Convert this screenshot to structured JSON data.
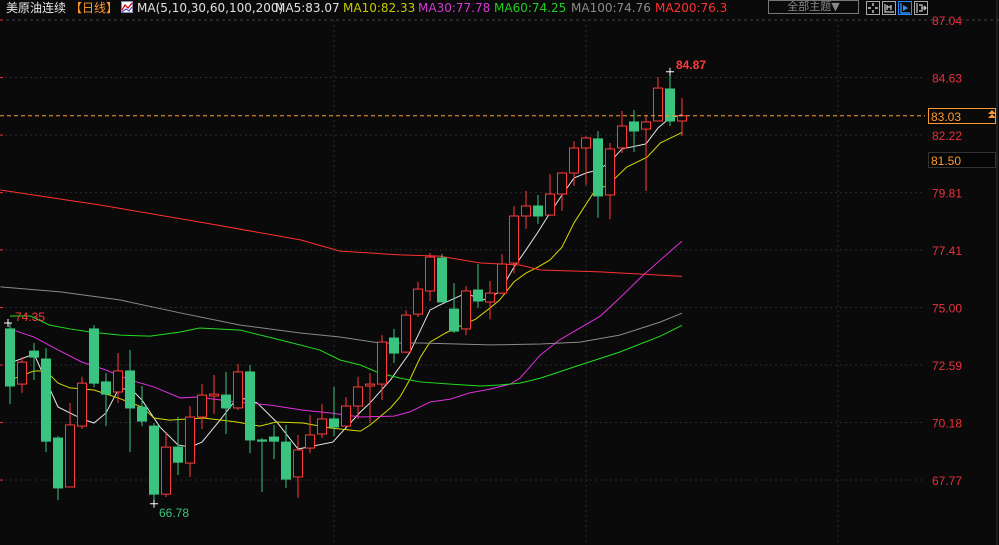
{
  "header": {
    "title": "美原油连续",
    "period": "【日线】",
    "ma_params": "MA(5,10,30,60,100,200)",
    "ma5": "MA5:83.07",
    "ma10": "MA10:82.33",
    "ma30": "MA30:77.78",
    "ma60": "MA60:74.25",
    "ma100": "MA100:74.76",
    "ma200": "MA200:76.3"
  },
  "toolbar": {
    "theme_dropdown": "全部主题▼",
    "icons": [
      "crosshair-icon",
      "range-icon",
      "play-icon",
      "move-right-icon"
    ]
  },
  "price_tags": {
    "current": "83.03",
    "cursor": "81.50"
  },
  "colors": {
    "background": "#0a0a0a",
    "up": "#ff3b3b",
    "down": "#3ac47f",
    "axis_text": "#e8323c",
    "ma5": "#e8e8e8",
    "ma10": "#d8d800",
    "ma30": "#e030e0",
    "ma60": "#22dd22",
    "ma100": "#8a8a8a",
    "ma200": "#ff3030",
    "current_line": "#ff9a2e"
  },
  "chart_data": {
    "type": "candlestick",
    "ylim": [
      65.05,
      87.04
    ],
    "y_ticks": [
      "87.04",
      "84.63",
      "82.22",
      "79.81",
      "77.41",
      "75.00",
      "72.59",
      "70.18",
      "67.77"
    ],
    "grid": true,
    "current_price": 83.03,
    "annotations": {
      "high": "84.87",
      "low": "66.78",
      "left_high": "74.35"
    },
    "ohlc": [
      [
        74.1,
        74.35,
        70.95,
        71.71
      ],
      [
        71.79,
        72.92,
        71.42,
        72.71
      ],
      [
        73.17,
        73.51,
        71.96,
        72.92
      ],
      [
        72.84,
        73.3,
        68.94,
        69.4
      ],
      [
        69.53,
        69.61,
        66.93,
        67.44
      ],
      [
        67.48,
        71.0,
        67.48,
        70.08
      ],
      [
        70.03,
        72.09,
        69.91,
        71.83
      ],
      [
        74.1,
        74.26,
        71.67,
        71.83
      ],
      [
        71.88,
        72.25,
        70.03,
        71.37
      ],
      [
        71.46,
        73.09,
        71.0,
        72.34
      ],
      [
        72.34,
        73.22,
        68.94,
        70.79
      ],
      [
        70.83,
        71.71,
        70.03,
        70.24
      ],
      [
        70.03,
        70.16,
        66.78,
        67.18
      ],
      [
        67.18,
        69.74,
        67.06,
        69.15
      ],
      [
        69.15,
        70.41,
        67.98,
        68.52
      ],
      [
        68.48,
        70.87,
        67.9,
        70.41
      ],
      [
        70.41,
        71.79,
        69.91,
        71.33
      ],
      [
        71.29,
        72.17,
        70.54,
        71.37
      ],
      [
        71.33,
        72.3,
        69.7,
        70.79
      ],
      [
        70.79,
        72.63,
        70.7,
        72.3
      ],
      [
        72.3,
        72.59,
        68.9,
        69.45
      ],
      [
        69.45,
        69.53,
        67.27,
        69.4
      ],
      [
        69.57,
        70.09,
        68.65,
        69.4
      ],
      [
        69.36,
        70.08,
        67.44,
        67.81
      ],
      [
        67.9,
        69.66,
        67.02,
        69.03
      ],
      [
        69.11,
        70.49,
        68.9,
        69.66
      ],
      [
        69.7,
        70.95,
        69.53,
        70.33
      ],
      [
        70.33,
        71.67,
        69.61,
        69.99
      ],
      [
        70.03,
        71.25,
        69.99,
        70.87
      ],
      [
        70.87,
        72.09,
        70.33,
        71.67
      ],
      [
        71.71,
        72.25,
        70.16,
        71.79
      ],
      [
        71.79,
        73.84,
        71.12,
        73.55
      ],
      [
        73.72,
        74.1,
        72.67,
        73.09
      ],
      [
        73.13,
        74.89,
        73.09,
        74.68
      ],
      [
        74.72,
        76.07,
        74.6,
        75.77
      ],
      [
        75.69,
        77.28,
        75.27,
        77.11
      ],
      [
        77.07,
        77.24,
        75.23,
        75.23
      ],
      [
        74.93,
        76.02,
        73.93,
        74.01
      ],
      [
        74.1,
        75.9,
        73.84,
        75.69
      ],
      [
        75.73,
        76.82,
        74.98,
        75.27
      ],
      [
        75.23,
        76.11,
        74.51,
        75.6
      ],
      [
        75.6,
        77.24,
        75.56,
        76.82
      ],
      [
        76.86,
        79.25,
        76.44,
        78.83
      ],
      [
        78.83,
        79.88,
        78.29,
        79.25
      ],
      [
        79.25,
        79.71,
        78.5,
        78.83
      ],
      [
        78.87,
        80.59,
        78.83,
        79.75
      ],
      [
        79.75,
        80.67,
        79.04,
        80.63
      ],
      [
        80.63,
        81.97,
        80.09,
        81.68
      ],
      [
        81.68,
        82.18,
        80.13,
        82.1
      ],
      [
        82.06,
        82.39,
        78.76,
        79.67
      ],
      [
        79.71,
        81.89,
        78.7,
        81.64
      ],
      [
        81.68,
        83.23,
        81.47,
        82.6
      ],
      [
        82.77,
        83.27,
        81.51,
        82.39
      ],
      [
        82.47,
        83.06,
        79.88,
        82.77
      ],
      [
        82.81,
        84.65,
        82.81,
        84.19
      ],
      [
        84.15,
        84.87,
        82.6,
        82.81
      ],
      [
        82.81,
        83.77,
        82.18,
        83.03
      ]
    ],
    "ma_series": [
      {
        "name": "MA5",
        "color": "#e8e8e8",
        "points": [
          [
            0,
            72.67
          ],
          [
            2,
            73.05
          ],
          [
            4,
            70.83
          ],
          [
            6,
            70.33
          ],
          [
            7,
            70.16
          ],
          [
            8,
            70.58
          ],
          [
            9,
            71.54
          ],
          [
            10,
            71.63
          ],
          [
            11,
            71.12
          ],
          [
            12.5,
            69.99
          ],
          [
            14,
            69.24
          ],
          [
            15,
            69.15
          ],
          [
            16,
            69.36
          ],
          [
            17.5,
            70.28
          ],
          [
            19,
            71.25
          ],
          [
            20.6,
            71.0
          ],
          [
            22.3,
            70.16
          ],
          [
            24,
            69.07
          ],
          [
            26.9,
            69.36
          ],
          [
            29.2,
            70.62
          ],
          [
            30,
            71.0
          ],
          [
            31.7,
            71.96
          ],
          [
            33.3,
            73.09
          ],
          [
            35,
            74.89
          ],
          [
            35.8,
            75.1
          ],
          [
            38,
            75.6
          ],
          [
            39.4,
            75.31
          ],
          [
            40.8,
            75.65
          ],
          [
            42,
            76.69
          ],
          [
            43,
            77.41
          ],
          [
            44,
            78.16
          ],
          [
            45,
            78.96
          ],
          [
            46,
            79.71
          ],
          [
            47,
            80.42
          ],
          [
            48,
            80.63
          ],
          [
            49,
            80.76
          ],
          [
            50,
            81.09
          ],
          [
            51,
            81.64
          ],
          [
            53,
            81.85
          ],
          [
            54,
            82.52
          ],
          [
            55,
            82.94
          ],
          [
            56,
            83.07
          ]
        ]
      },
      {
        "name": "MA10",
        "color": "#d8d800",
        "points": [
          [
            0,
            71.96
          ],
          [
            2,
            72.34
          ],
          [
            3,
            72.34
          ],
          [
            4,
            71.83
          ],
          [
            5,
            71.63
          ],
          [
            7,
            71.54
          ],
          [
            9,
            71.21
          ],
          [
            11,
            70.83
          ],
          [
            12,
            70.37
          ],
          [
            13.3,
            70.28
          ],
          [
            16.1,
            70.37
          ],
          [
            18.9,
            70.2
          ],
          [
            20.8,
            70.03
          ],
          [
            22.2,
            70.2
          ],
          [
            24.4,
            70.16
          ],
          [
            26.7,
            69.95
          ],
          [
            29.2,
            69.82
          ],
          [
            30,
            70.07
          ],
          [
            31.7,
            70.79
          ],
          [
            32.5,
            71.25
          ],
          [
            33.3,
            71.96
          ],
          [
            34.2,
            72.92
          ],
          [
            35,
            73.55
          ],
          [
            36.3,
            73.93
          ],
          [
            37.5,
            74.22
          ],
          [
            38.8,
            74.51
          ],
          [
            40,
            74.98
          ],
          [
            40.8,
            75.31
          ],
          [
            42,
            76.07
          ],
          [
            43,
            76.44
          ],
          [
            44,
            76.69
          ],
          [
            45,
            76.99
          ],
          [
            46,
            77.53
          ],
          [
            47,
            78.54
          ],
          [
            48.6,
            79.79
          ],
          [
            50,
            80.21
          ],
          [
            51.4,
            80.88
          ],
          [
            53.1,
            81.3
          ],
          [
            54.2,
            81.89
          ],
          [
            56,
            82.33
          ]
        ]
      },
      {
        "name": "MA30",
        "color": "#e030e0",
        "points": [
          [
            0,
            74.1
          ],
          [
            2,
            73.76
          ],
          [
            4,
            73.22
          ],
          [
            6,
            72.71
          ],
          [
            8,
            72.38
          ],
          [
            10,
            71.96
          ],
          [
            12,
            71.67
          ],
          [
            14.2,
            71.21
          ],
          [
            15.6,
            71.25
          ],
          [
            18.9,
            71.04
          ],
          [
            21.7,
            70.91
          ],
          [
            24.4,
            70.7
          ],
          [
            26.7,
            70.58
          ],
          [
            29.2,
            70.41
          ],
          [
            32,
            70.45
          ],
          [
            33.3,
            70.62
          ],
          [
            35,
            71.04
          ],
          [
            36.7,
            71.16
          ],
          [
            38.3,
            71.42
          ],
          [
            40,
            71.58
          ],
          [
            41.7,
            71.79
          ],
          [
            42.5,
            72.04
          ],
          [
            44.2,
            73.01
          ],
          [
            45.8,
            73.64
          ],
          [
            47.5,
            74.14
          ],
          [
            49.2,
            74.64
          ],
          [
            50.8,
            75.39
          ],
          [
            52.5,
            76.23
          ],
          [
            54.2,
            76.99
          ],
          [
            56,
            77.78
          ]
        ]
      },
      {
        "name": "MA60",
        "color": "#22dd22",
        "points": [
          [
            0,
            74.64
          ],
          [
            1.7,
            74.64
          ],
          [
            3.3,
            74.26
          ],
          [
            5,
            74.1
          ],
          [
            6.7,
            73.97
          ],
          [
            9.2,
            73.84
          ],
          [
            11.7,
            73.8
          ],
          [
            14.2,
            73.97
          ],
          [
            15.8,
            74.14
          ],
          [
            19.2,
            74.05
          ],
          [
            22.5,
            73.64
          ],
          [
            25.8,
            73.22
          ],
          [
            27.5,
            72.8
          ],
          [
            29.2,
            72.59
          ],
          [
            30.8,
            72.25
          ],
          [
            32.5,
            72.04
          ],
          [
            34.2,
            71.88
          ],
          [
            36.7,
            71.79
          ],
          [
            39.2,
            71.71
          ],
          [
            40.8,
            71.75
          ],
          [
            42.5,
            71.83
          ],
          [
            44.2,
            72.04
          ],
          [
            47.5,
            72.59
          ],
          [
            50.8,
            73.13
          ],
          [
            54.2,
            73.8
          ],
          [
            56,
            74.25
          ]
        ]
      },
      {
        "name": "MA100",
        "color": "#8a8a8a",
        "points": [
          [
            -0.8,
            75.86
          ],
          [
            4.2,
            75.65
          ],
          [
            9.2,
            75.31
          ],
          [
            14.2,
            74.77
          ],
          [
            19.2,
            74.26
          ],
          [
            24.2,
            73.93
          ],
          [
            27.5,
            73.76
          ],
          [
            30.8,
            73.51
          ],
          [
            34.2,
            73.51
          ],
          [
            40,
            73.43
          ],
          [
            44.2,
            73.47
          ],
          [
            47.5,
            73.55
          ],
          [
            50.8,
            73.84
          ],
          [
            54.2,
            74.39
          ],
          [
            56,
            74.76
          ]
        ]
      },
      {
        "name": "MA200",
        "color": "#ff3030",
        "points": [
          [
            -0.8,
            79.92
          ],
          [
            7.5,
            79.29
          ],
          [
            15.8,
            78.58
          ],
          [
            24.2,
            77.83
          ],
          [
            27.5,
            77.36
          ],
          [
            32.5,
            77.2
          ],
          [
            35.8,
            77.15
          ],
          [
            39.2,
            76.86
          ],
          [
            42.5,
            76.78
          ],
          [
            44.2,
            76.57
          ],
          [
            49.2,
            76.49
          ],
          [
            56,
            76.3
          ]
        ]
      }
    ]
  }
}
